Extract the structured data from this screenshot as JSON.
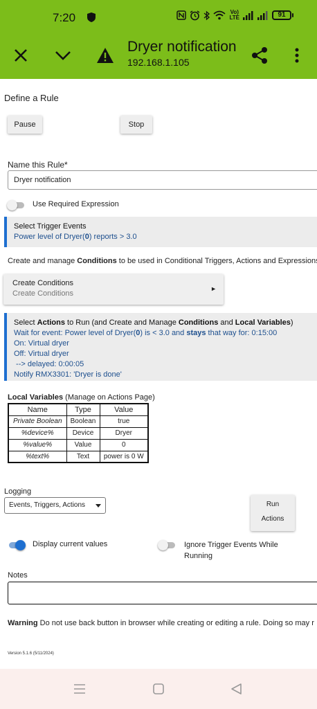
{
  "status": {
    "time": "7:20",
    "battery": "91",
    "network": "VoLTE"
  },
  "appbar": {
    "title": "Dryer notification",
    "subtitle": "192.168.1.105"
  },
  "page": {
    "title": "Define a Rule",
    "pause_label": "Pause",
    "stop_label": "Stop",
    "name_label": "Name this Rule*",
    "name_value": "Dryer notification",
    "required_expr_label": "Use Required Expression",
    "trigger": {
      "heading": "Select Trigger Events",
      "line_prefix": "Power level of Dryer(",
      "line_bold": "0",
      "line_suffix": ") reports > 3.0"
    },
    "conditions_intro": {
      "pre": "Create and manage ",
      "bold": "Conditions",
      "post": " to be used in Conditional Triggers, Actions and Expressions"
    },
    "create_conditions": {
      "title": "Create Conditions",
      "subtitle": "Create Conditions",
      "arrow": "►"
    },
    "actions": {
      "h1": "Select ",
      "h2": "Actions",
      "h3": " to Run (and Create and Manage ",
      "h4": "Conditions",
      "h5": " and ",
      "h6": "Local Variables",
      "h7": ")",
      "wait_pre": "Wait for event: Power level of Dryer(",
      "wait_bold": "0",
      "wait_mid": ") is < 3.0 and ",
      "wait_bold2": "stays",
      "wait_post": " that way for: 0:15:00",
      "lines": [
        "On: Virtual dryer",
        "Off: Virtual dryer",
        " --> delayed: 0:00:05",
        "Notify RMX3301: 'Dryer is done'"
      ]
    },
    "local_vars": {
      "title_bold": "Local Variables",
      "title_rest": " (Manage on Actions Page)",
      "headers": [
        "Name",
        "Type",
        "Value"
      ],
      "rows": [
        [
          "Private Boolean",
          "Boolean",
          "true"
        ],
        [
          "%device%",
          "Device",
          "Dryer"
        ],
        [
          "%value%",
          "Value",
          "0"
        ],
        [
          "%text%",
          "Text",
          "power is 0 W"
        ]
      ]
    },
    "logging": {
      "label": "Logging",
      "selected": "Events, Triggers, Actions"
    },
    "run_actions": {
      "line1": "Run",
      "line2": "Actions"
    },
    "display_current_values": "Display current values",
    "ignore_trigger": "Ignore Trigger Events While Running",
    "notes_label": "Notes",
    "warning": {
      "bold": "Warning",
      "text": " Do not use back button in browser while creating or editing a rule. Doing so may r"
    },
    "version": "Version 5.1.6 (5/11/2024)"
  }
}
